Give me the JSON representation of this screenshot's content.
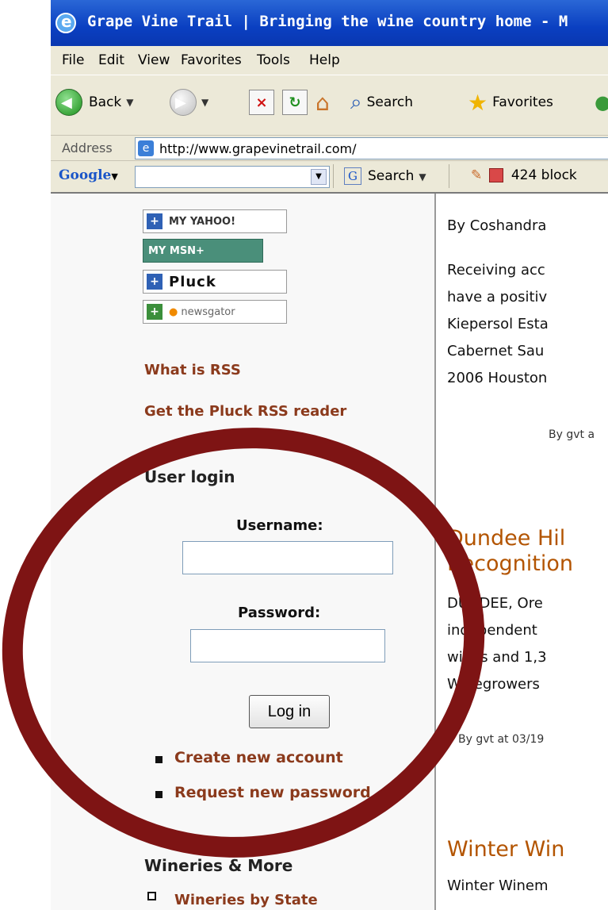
{
  "window": {
    "title": "Grape Vine Trail | Bringing the wine country home - M"
  },
  "menu": [
    "File",
    "Edit",
    "View",
    "Favorites",
    "Tools",
    "Help"
  ],
  "toolbar": {
    "back_label": "Back",
    "search_label": "Search",
    "favorites_label": "Favorites"
  },
  "address": {
    "label": "Address",
    "url": "http://www.grapevinetrail.com/"
  },
  "google_bar": {
    "logo": "Google",
    "search_label": "Search",
    "blocked_label": "424 block"
  },
  "sidebar": {
    "feeds": [
      {
        "label": "MY YAHOO!",
        "kind": "yahoo"
      },
      {
        "label": "MY MSN+",
        "kind": "msn"
      },
      {
        "label": "Pluck",
        "kind": "pluck"
      },
      {
        "label": "newsgator",
        "kind": "newsgator"
      }
    ],
    "what_is_rss": "What is RSS",
    "get_pluck": "Get the Pluck RSS reader",
    "login": {
      "heading": "User login",
      "username_label": "Username:",
      "password_label": "Password:",
      "button": "Log in",
      "create_account": "Create new account",
      "request_password": "Request new password"
    },
    "wineries_heading": "Wineries & More",
    "wineries_by_state": "Wineries by State"
  },
  "main": {
    "byline_top": "By Coshandra",
    "article1_lines": [
      "Receiving acc",
      "have a positiv",
      "Kiepersol Esta",
      "Cabernet Sau",
      "2006 Houston"
    ],
    "article1_meta": "By gvt a",
    "article2_title_lines": [
      "Dundee Hil",
      "Recognition"
    ],
    "article2_lines": [
      "DUNDEE, Ore",
      "independent",
      "wines and 1,3",
      "Winegrowers"
    ],
    "article2_meta": "By gvt at 03/19",
    "article3_title": "Winter Win",
    "article3_line": "Winter Winem"
  },
  "colors": {
    "link": "#8b3a1c",
    "article_title": "#b35400",
    "annotation_circle": "#7e1414"
  }
}
